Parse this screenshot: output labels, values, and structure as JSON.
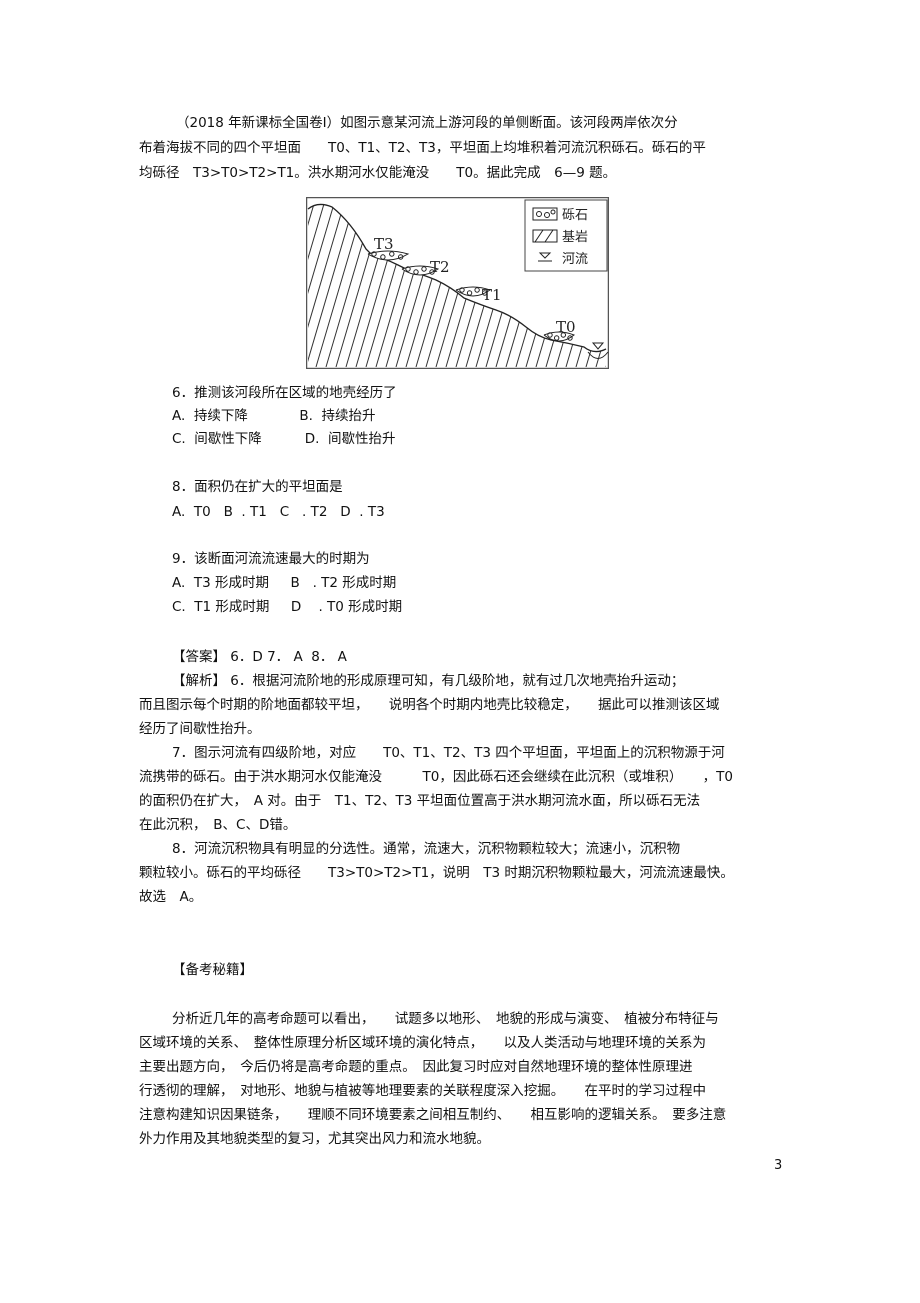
{
  "intro": [
    "（2018 年新课标全国卷Ⅰ）如图示意某河流上游河段的单侧断面。该河段两岸依次分",
    "布着海拔不同的四个平坦面　　T0、T1、T2、T3，平坦面上均堆积着河流沉积砾石。砾石的平",
    "均砾径　T3>T0>T2>T1。洪水期河水仅能淹没　　T0。据此完成　6—9 题。"
  ],
  "figure": {
    "terraces": [
      "T3",
      "T2",
      "T1",
      "T0"
    ],
    "legend": [
      "砾石",
      "基岩",
      "河流"
    ]
  },
  "q6": [
    "6．推测该河段所在区域的地壳经历了",
    "A.  持续下降            B.  持续抬升",
    "C.  间歇性下降          D.  间歇性抬升"
  ],
  "q8": [
    "8．面积仍在扩大的平坦面是",
    "A.  T0   B  . T1   C   . T2   D  . T3"
  ],
  "q9": [
    "9．该断面河流流速最大的时期为",
    "A.  T3 形成时期     B   . T2 形成时期",
    "C.  T1 形成时期     D    . T0 形成时期"
  ],
  "answer": [
    "【答案】 6．D 7． A  8． A",
    "【解析】 6．根据河流阶地的形成原理可知，有几级阶地，就有过几次地壳抬升运动；",
    "而且图示每个时期的阶地面都较平坦，　　说明各个时期内地壳比较稳定，　　据此可以推测该区域",
    "经历了间歇性抬升。",
    "7．图示河流有四级阶地，对应　　T0、T1、T2、T3 四个平坦面，平坦面上的沉积物源于河",
    "流携带的砾石。由于洪水期河水仅能淹没　　　T0，因此砾石还会继续在此沉积（或堆积）　　，T0",
    "的面积仍在扩大，　A 对。由于　T1、T2、T3 平坦面位置高于洪水期河流水面，所以砾石无法",
    "在此沉积，　B、C、D错。",
    "8．河流沉积物具有明显的分选性。通常，流速大，沉积物颗粒较大；流速小，沉积物",
    "颗粒较小。砾石的平均砾径　　T3>T0>T2>T1，说明　T3 时期沉积物颗粒最大，河流流速最快。",
    "故选　A。"
  ],
  "tips_title": "【备考秘籍】",
  "tips": [
    "分析近几年的高考命题可以看出，　　试题多以地形、　地貌的形成与演变、　植被分布特征与",
    "区域环境的关系、　整体性原理分析区域环境的演化特点，　　以及人类活动与地理环境的关系为",
    "主要出题方向，　今后仍将是高考命题的重点。　因此复习时应对自然地理环境的整体性原理进",
    "行透彻的理解，　对地形、地貌与植被等地理要素的关联程度深入挖掘。　　在平时的学习过程中",
    "注意构建知识因果链条，　　理顺不同环境要素之间相互制约、　　相互影响的逻辑关系。　要多注意",
    "外力作用及其地貌类型的复习，尤其突出风力和流水地貌。"
  ],
  "page_number": "3"
}
